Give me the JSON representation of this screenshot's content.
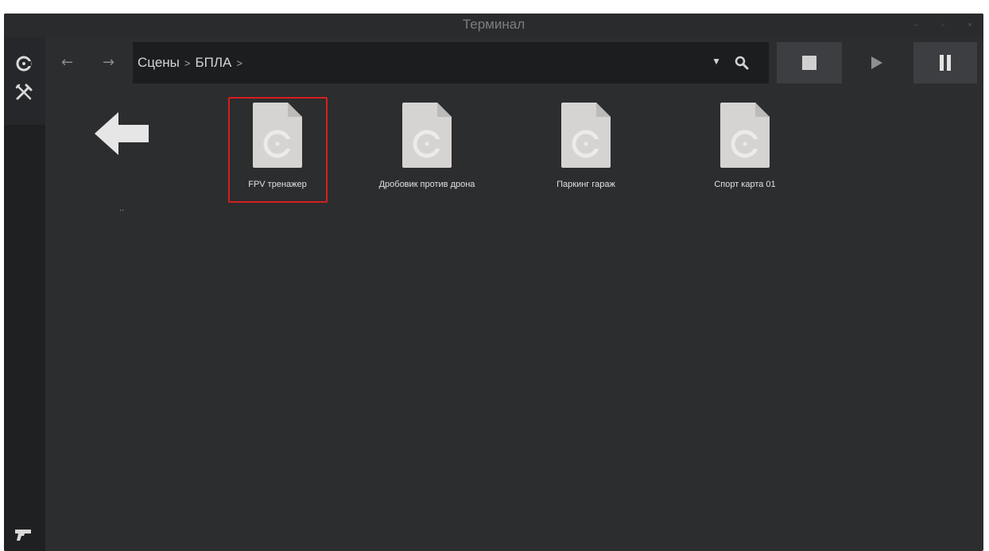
{
  "window": {
    "title": "Терминал",
    "controls": [
      "–",
      "▫",
      "×"
    ]
  },
  "sidebar": {
    "items": [
      {
        "name": "scene-logo-icon"
      },
      {
        "name": "tools-icon"
      },
      {
        "name": "pistol-icon"
      }
    ]
  },
  "toolbar": {
    "back": "←",
    "forward": "→",
    "breadcrumb": [
      "Сцены",
      "БПЛА"
    ],
    "separator": ">",
    "dropdown": "▼"
  },
  "files": {
    "up_label": "..",
    "items": [
      {
        "label": "FPV тренажер",
        "selected": true
      },
      {
        "label": "Дробовик против дрона",
        "selected": false
      },
      {
        "label": "Паркинг гараж",
        "selected": false
      },
      {
        "label": "Спорт карта 01",
        "selected": false
      }
    ]
  },
  "colors": {
    "background": "#2c2d2f",
    "selection": "#d81e1e",
    "file_icon": "#d6d4d2"
  }
}
